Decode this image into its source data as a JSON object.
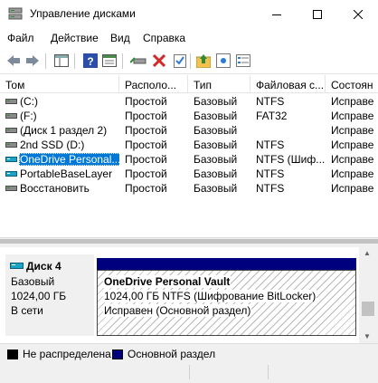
{
  "window": {
    "title": "Управление дисками"
  },
  "menu": [
    "Файл",
    "Действие",
    "Вид",
    "Справка"
  ],
  "toolbar": {
    "icons": [
      "back-arrow-icon",
      "forward-arrow-icon",
      "console-tree-icon",
      "help-icon",
      "properties-icon",
      "connect-disk-icon",
      "delete-icon",
      "check-icon",
      "folder-up-icon",
      "rescan-icon",
      "settings-list-icon"
    ]
  },
  "table": {
    "columns": [
      "Том",
      "Располо...",
      "Тип",
      "Файловая с...",
      "Состоян"
    ],
    "rows": [
      {
        "name": "(C:)",
        "layout": "Простой",
        "type": "Базовый",
        "fs": "NTFS",
        "status": "Исправе",
        "icon": "disk-volume-icon"
      },
      {
        "name": "(F:)",
        "layout": "Простой",
        "type": "Базовый",
        "fs": "FAT32",
        "status": "Исправе",
        "icon": "disk-volume-icon"
      },
      {
        "name": "(Диск 1 раздел 2)",
        "layout": "Простой",
        "type": "Базовый",
        "fs": "",
        "status": "Исправе",
        "icon": "disk-volume-icon"
      },
      {
        "name": "2nd SSD (D:)",
        "layout": "Простой",
        "type": "Базовый",
        "fs": "NTFS",
        "status": "Исправе",
        "icon": "disk-volume-icon"
      },
      {
        "name": "OneDrive Personal...",
        "layout": "Простой",
        "type": "Базовый",
        "fs": "NTFS (Шиф...",
        "status": "Исправе",
        "icon": "virtual-disk-icon",
        "selected": true
      },
      {
        "name": "PortableBaseLayer",
        "layout": "Простой",
        "type": "Базовый",
        "fs": "NTFS",
        "status": "Исправе",
        "icon": "virtual-disk-icon"
      },
      {
        "name": "Восстановить",
        "layout": "Простой",
        "type": "Базовый",
        "fs": "NTFS",
        "status": "Исправе",
        "icon": "disk-volume-icon"
      }
    ]
  },
  "disk": {
    "name": "Диск 4",
    "type": "Базовый",
    "size": "1024,00 ГБ",
    "state": "В сети",
    "partition": {
      "name": "OneDrive Personal Vault",
      "detail": "1024,00 ГБ NTFS (Шифрование BitLocker)",
      "status": "Исправен (Основной раздел)"
    }
  },
  "legend": [
    {
      "label": "Не распределена",
      "color": "#000000"
    },
    {
      "label": "Основной раздел",
      "color": "#00007f"
    }
  ],
  "colors": {
    "selection": "#0078d7",
    "primary_partition": "#00007f",
    "virtual_disk": "#1aa4c8"
  }
}
